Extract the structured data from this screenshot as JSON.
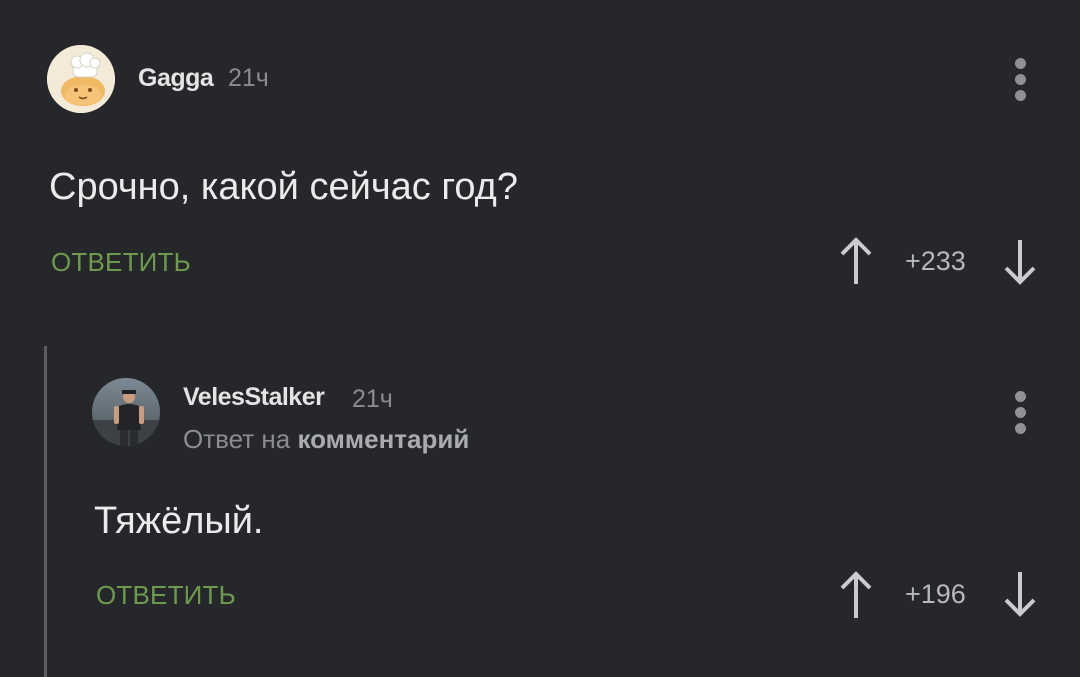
{
  "comments": [
    {
      "author": "Gagga",
      "time": "21ч",
      "text": "Срочно, какой сейчас год?",
      "reply_label": "ОТВЕТИТЬ",
      "score": "+233",
      "avatar_icon": "chef-cat-avatar",
      "menu_icon": "more-vertical-icon"
    },
    {
      "author": "VelesStalker",
      "time": "21ч",
      "reply_to_prefix": "Ответ на",
      "reply_to_link": "комментарий",
      "text": "Тяжёлый.",
      "reply_label": "ОТВЕТИТЬ",
      "score": "+196",
      "avatar_icon": "user-photo-avatar",
      "menu_icon": "more-vertical-icon"
    }
  ],
  "colors": {
    "background": "#25272a",
    "reply_green": "#6e9a4d",
    "muted_text": "#8a8c8f",
    "thread_line": "#5b5d60"
  }
}
